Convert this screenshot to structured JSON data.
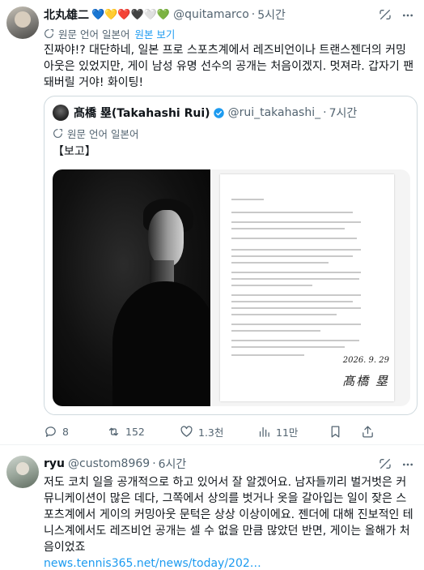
{
  "post1": {
    "name": "北丸雄二",
    "hearts": "💙💛❤️🖤🤍💚",
    "handle": "@quitamarco",
    "time": "5시간",
    "translation": {
      "label": "원문 언어 일본어",
      "show_original": "원본 보기"
    },
    "text": "진짜야!? 대단하네, 일본 프로 스포츠계에서 레즈비언이나 트랜스젠더의 커밍아웃은 있었지만, 게이 남성 유명 선수의 공개는 처음이겠지. 멋져라. 갑자기 팬 돼버릴 거야! 화이팅!",
    "quote": {
      "name": "髙橋 塁(Takahashi Rui)",
      "handle": "@rui_takahashi_",
      "time": "7시간",
      "translation": "원문 언어 일본어",
      "text": "【보고】",
      "doc_date": "2026. 9. 29",
      "doc_signature": "髙橋 塁"
    },
    "actions": {
      "replies": "8",
      "reposts": "152",
      "likes": "1.3천",
      "views": "11만"
    }
  },
  "post2": {
    "name": "ryu",
    "handle": "@custom8969",
    "time": "6시간",
    "text": "저도 코치 일을 공개적으로 하고 있어서 잘 알겠어요. 남자들끼리 벌거벗은 커뮤니케이션이 많은 데다, 그쪽에서 상의를 벗거나 옷을 갈아입는 일이 잦은 스포츠계에서 게이의 커밍아웃 문턱은 상상 이상이에요. 젠더에 대해 진보적인 테니스계에서도 레즈비언 공개는 셀 수 없을 만큼 많았던 반면, 게이는 올해가 처음이었죠",
    "link": "news.tennis365.net/news/today/202…"
  },
  "colors": {
    "accent": "#1d9bf0",
    "muted": "#536471",
    "text": "#0f1419",
    "border": "#cfd9de"
  },
  "icons": [
    "grok-icon",
    "more-icon",
    "translate-icon",
    "verified-icon",
    "reply-icon",
    "repost-icon",
    "like-icon",
    "views-icon",
    "bookmark-icon",
    "share-icon"
  ]
}
